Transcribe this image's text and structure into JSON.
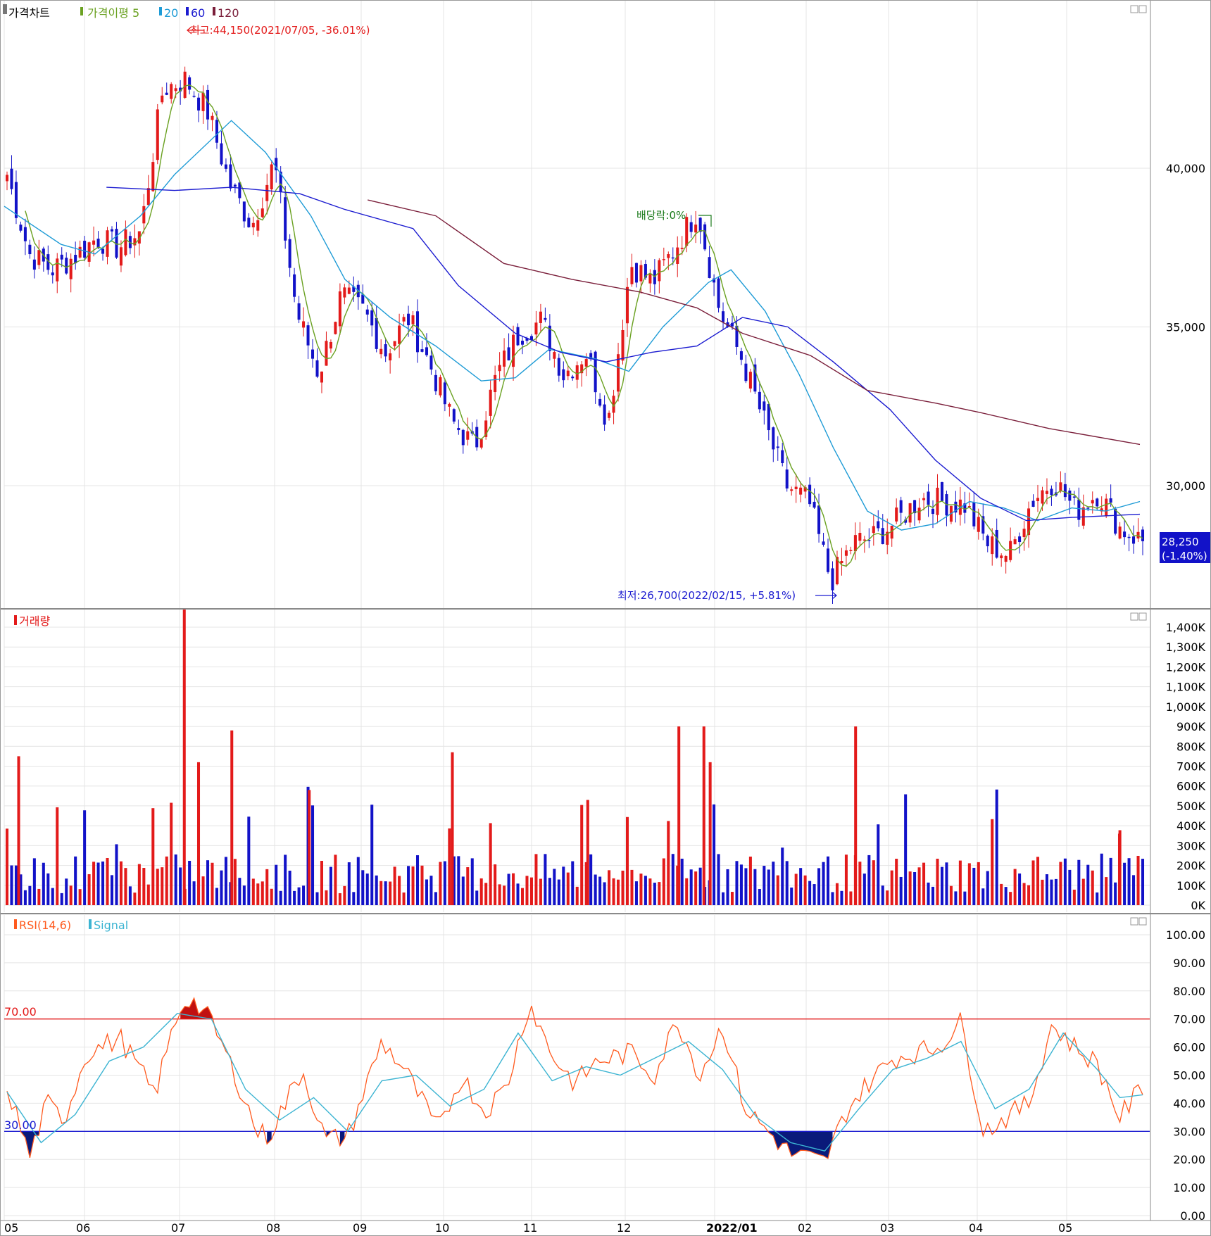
{
  "price_panel": {
    "legend": [
      {
        "text": "가격차트",
        "color": "#000000"
      },
      {
        "text": "가격이평 5",
        "color": "#6aa121"
      },
      {
        "text": "20",
        "color": "#1e9bd6"
      },
      {
        "text": "60",
        "color": "#1b1bd0"
      },
      {
        "text": "120",
        "color": "#7a1e3a"
      }
    ],
    "high_annotation": "최고:44,150(2021/07/05, -36.01%)",
    "low_annotation": "최저:26,700(2022/02/15, +5.81%)",
    "dividend_annotation": "배당락:0%",
    "current_price": "28,250",
    "current_change": "(-1.40%)",
    "y_ticks": [
      "40,000",
      "35,000",
      "30,000"
    ]
  },
  "volume_panel": {
    "legend": "거래량",
    "y_ticks": [
      "1,400K",
      "1,300K",
      "1,200K",
      "1,100K",
      "1,000K",
      "900K",
      "800K",
      "700K",
      "600K",
      "500K",
      "400K",
      "300K",
      "200K",
      "100K",
      "0K"
    ]
  },
  "rsi_panel": {
    "legend_rsi": "RSI(14,6)",
    "legend_signal": "Signal",
    "y_ticks": [
      "100.00",
      "90.00",
      "80.00",
      "70.00",
      "60.00",
      "50.00",
      "40.00",
      "30.00",
      "20.00",
      "10.00",
      "0.00"
    ],
    "level_high": "70.00",
    "level_low": "30.00"
  },
  "x_axis": {
    "labels": [
      "05",
      "06",
      "07",
      "08",
      "09",
      "10",
      "11",
      "12",
      "2022/01",
      "02",
      "03",
      "04",
      "05"
    ]
  },
  "colors": {
    "up": "#e31a1a",
    "down": "#1212c8",
    "ma5": "#6aa121",
    "ma20": "#1e9bd6",
    "ma60": "#1b1bd0",
    "ma120": "#7a1e3a",
    "rsi": "#ff5a1e",
    "signal": "#3cb4d2",
    "grid": "#e4e4e4"
  },
  "chart_data": [
    {
      "type": "candlestick",
      "title": "가격차트",
      "x": [
        "05",
        "06",
        "07",
        "08",
        "09",
        "10",
        "11",
        "12",
        "2022/01",
        "02",
        "03",
        "04",
        "05"
      ],
      "close_path": [
        {
          "x": "05",
          "v": 39800
        },
        {
          "x": "05",
          "v": 37300
        },
        {
          "x": "05",
          "v": 36800
        },
        {
          "x": "06",
          "v": 37200
        },
        {
          "x": "06",
          "v": 37800
        },
        {
          "x": "06",
          "v": 37500
        },
        {
          "x": "07",
          "v": 38000
        },
        {
          "x": "07",
          "v": 42500
        },
        {
          "x": "07",
          "v": 42800
        },
        {
          "x": "07",
          "v": 41800
        },
        {
          "x": "08",
          "v": 39500
        },
        {
          "x": "08",
          "v": 38200
        },
        {
          "x": "08",
          "v": 40200
        },
        {
          "x": "08",
          "v": 35500
        },
        {
          "x": "08",
          "v": 33500
        },
        {
          "x": "09",
          "v": 36000
        },
        {
          "x": "09",
          "v": 35500
        },
        {
          "x": "09",
          "v": 34200
        },
        {
          "x": "09",
          "v": 35300
        },
        {
          "x": "10",
          "v": 33800
        },
        {
          "x": "10",
          "v": 32000
        },
        {
          "x": "10",
          "v": 31200
        },
        {
          "x": "10",
          "v": 33500
        },
        {
          "x": "11",
          "v": 34800
        },
        {
          "x": "11",
          "v": 35200
        },
        {
          "x": "11",
          "v": 33500
        },
        {
          "x": "11",
          "v": 34200
        },
        {
          "x": "12",
          "v": 32000
        },
        {
          "x": "12",
          "v": 37000
        },
        {
          "x": "12",
          "v": 36400
        },
        {
          "x": "12",
          "v": 37500
        },
        {
          "x": "2022/01",
          "v": 38700
        },
        {
          "x": "2022/01",
          "v": 35500
        },
        {
          "x": "2022/01",
          "v": 34000
        },
        {
          "x": "2022/01",
          "v": 32000
        },
        {
          "x": "02",
          "v": 30000
        },
        {
          "x": "02",
          "v": 29500
        },
        {
          "x": "02",
          "v": 27000
        },
        {
          "x": "02",
          "v": 28200
        },
        {
          "x": "03",
          "v": 28400
        },
        {
          "x": "03",
          "v": 28900
        },
        {
          "x": "03",
          "v": 29600
        },
        {
          "x": "03",
          "v": 29500
        },
        {
          "x": "04",
          "v": 29400
        },
        {
          "x": "04",
          "v": 28200
        },
        {
          "x": "04",
          "v": 27800
        },
        {
          "x": "04",
          "v": 29500
        },
        {
          "x": "05",
          "v": 30200
        },
        {
          "x": "05",
          "v": 29200
        },
        {
          "x": "05",
          "v": 29800
        },
        {
          "x": "05",
          "v": 28650
        },
        {
          "x": "05",
          "v": 28250
        }
      ],
      "ma_series": [
        {
          "name": "20",
          "points": [
            [
              0,
              38800
            ],
            [
              0.05,
              37600
            ],
            [
              0.08,
              37300
            ],
            [
              0.12,
              38500
            ],
            [
              0.15,
              39800
            ],
            [
              0.2,
              41500
            ],
            [
              0.23,
              40500
            ],
            [
              0.27,
              38500
            ],
            [
              0.3,
              36500
            ],
            [
              0.34,
              35300
            ],
            [
              0.38,
              34400
            ],
            [
              0.42,
              33300
            ],
            [
              0.45,
              33400
            ],
            [
              0.48,
              34300
            ],
            [
              0.52,
              34000
            ],
            [
              0.55,
              33600
            ],
            [
              0.58,
              35000
            ],
            [
              0.62,
              36400
            ],
            [
              0.64,
              36800
            ],
            [
              0.67,
              35500
            ],
            [
              0.7,
              33500
            ],
            [
              0.73,
              31200
            ],
            [
              0.76,
              29200
            ],
            [
              0.79,
              28600
            ],
            [
              0.82,
              28800
            ],
            [
              0.85,
              29500
            ],
            [
              0.88,
              29300
            ],
            [
              0.91,
              28900
            ],
            [
              0.94,
              29300
            ],
            [
              0.97,
              29200
            ],
            [
              1,
              29500
            ]
          ]
        },
        {
          "name": "60",
          "points": [
            [
              0.09,
              39400
            ],
            [
              0.15,
              39300
            ],
            [
              0.2,
              39400
            ],
            [
              0.26,
              39200
            ],
            [
              0.3,
              38700
            ],
            [
              0.36,
              38100
            ],
            [
              0.4,
              36300
            ],
            [
              0.45,
              34800
            ],
            [
              0.49,
              34200
            ],
            [
              0.53,
              33900
            ],
            [
              0.57,
              34200
            ],
            [
              0.61,
              34400
            ],
            [
              0.65,
              35300
            ],
            [
              0.69,
              35000
            ],
            [
              0.73,
              33900
            ],
            [
              0.78,
              32400
            ],
            [
              0.82,
              30800
            ],
            [
              0.86,
              29600
            ],
            [
              0.9,
              28900
            ],
            [
              0.94,
              29000
            ],
            [
              1,
              29100
            ]
          ]
        },
        {
          "name": "120",
          "points": [
            [
              0.32,
              39000
            ],
            [
              0.38,
              38500
            ],
            [
              0.44,
              37000
            ],
            [
              0.5,
              36500
            ],
            [
              0.56,
              36100
            ],
            [
              0.61,
              35600
            ],
            [
              0.65,
              34800
            ],
            [
              0.71,
              34100
            ],
            [
              0.76,
              33000
            ],
            [
              0.82,
              32600
            ],
            [
              0.86,
              32300
            ],
            [
              0.92,
              31800
            ],
            [
              1,
              31300
            ]
          ]
        }
      ],
      "ylim": [
        26000,
        44500
      ],
      "annotations": [
        "최고:44,150(2021/07/05, -36.01%)",
        "최저:26,700(2022/02/15, +5.81%)",
        "배당락:0%"
      ],
      "last": {
        "price": 28250,
        "change_pct": -1.4
      }
    },
    {
      "type": "bar",
      "title": "거래량",
      "units": "K",
      "notable_values": [
        {
          "x": "05",
          "v": 750
        },
        {
          "x": "07",
          "v": 1490
        },
        {
          "x": "07",
          "v": 720
        },
        {
          "x": "07",
          "v": 880
        },
        {
          "x": "08",
          "v": 580
        },
        {
          "x": "10",
          "v": 770
        },
        {
          "x": "11",
          "v": 530
        },
        {
          "x": "12",
          "v": 900
        },
        {
          "x": "12",
          "v": 900
        },
        {
          "x": "12",
          "v": 720
        },
        {
          "x": "02",
          "v": 900
        },
        {
          "x": "05",
          "v": 360
        }
      ],
      "typical_range": [
        60,
        300
      ],
      "ylim": [
        0,
        1500
      ]
    },
    {
      "type": "line",
      "title": "RSI(14,6)",
      "series": [
        {
          "name": "RSI(14,6)",
          "points": [
            [
              0,
              46
            ],
            [
              0.02,
              21
            ],
            [
              0.035,
              40
            ],
            [
              0.05,
              34
            ],
            [
              0.07,
              58
            ],
            [
              0.1,
              63
            ],
            [
              0.13,
              43
            ],
            [
              0.15,
              72
            ],
            [
              0.16,
              78
            ],
            [
              0.18,
              69
            ],
            [
              0.2,
              51
            ],
            [
              0.22,
              30
            ],
            [
              0.23,
              28
            ],
            [
              0.26,
              52
            ],
            [
              0.28,
              27
            ],
            [
              0.3,
              28
            ],
            [
              0.33,
              62
            ],
            [
              0.35,
              52
            ],
            [
              0.38,
              30
            ],
            [
              0.4,
              50
            ],
            [
              0.42,
              37
            ],
            [
              0.44,
              46
            ],
            [
              0.46,
              76
            ],
            [
              0.48,
              57
            ],
            [
              0.5,
              47
            ],
            [
              0.52,
              55
            ],
            [
              0.55,
              58
            ],
            [
              0.57,
              50
            ],
            [
              0.59,
              70
            ],
            [
              0.61,
              50
            ],
            [
              0.63,
              68
            ],
            [
              0.65,
              38
            ],
            [
              0.67,
              30
            ],
            [
              0.69,
              22
            ],
            [
              0.71,
              20
            ],
            [
              0.72,
              19
            ],
            [
              0.74,
              38
            ],
            [
              0.76,
              48
            ],
            [
              0.78,
              56
            ],
            [
              0.8,
              58
            ],
            [
              0.82,
              60
            ],
            [
              0.84,
              69
            ],
            [
              0.86,
              30
            ],
            [
              0.88,
              35
            ],
            [
              0.9,
              40
            ],
            [
              0.92,
              68
            ],
            [
              0.94,
              60
            ],
            [
              0.96,
              54
            ],
            [
              0.98,
              35
            ],
            [
              1,
              46
            ]
          ]
        },
        {
          "name": "Signal",
          "points": [
            [
              0,
              44
            ],
            [
              0.03,
              26
            ],
            [
              0.06,
              36
            ],
            [
              0.09,
              55
            ],
            [
              0.12,
              60
            ],
            [
              0.15,
              72
            ],
            [
              0.18,
              70
            ],
            [
              0.21,
              45
            ],
            [
              0.24,
              34
            ],
            [
              0.27,
              42
            ],
            [
              0.3,
              30
            ],
            [
              0.33,
              48
            ],
            [
              0.36,
              50
            ],
            [
              0.39,
              39
            ],
            [
              0.42,
              45
            ],
            [
              0.45,
              65
            ],
            [
              0.48,
              48
            ],
            [
              0.51,
              53
            ],
            [
              0.54,
              50
            ],
            [
              0.57,
              56
            ],
            [
              0.6,
              62
            ],
            [
              0.63,
              52
            ],
            [
              0.66,
              35
            ],
            [
              0.69,
              26
            ],
            [
              0.72,
              23
            ],
            [
              0.75,
              38
            ],
            [
              0.78,
              52
            ],
            [
              0.81,
              56
            ],
            [
              0.84,
              62
            ],
            [
              0.87,
              38
            ],
            [
              0.9,
              45
            ],
            [
              0.93,
              65
            ],
            [
              0.96,
              52
            ],
            [
              0.98,
              42
            ],
            [
              1,
              43
            ]
          ]
        }
      ],
      "levels": [
        70,
        30
      ],
      "ylim": [
        0,
        100
      ]
    }
  ]
}
